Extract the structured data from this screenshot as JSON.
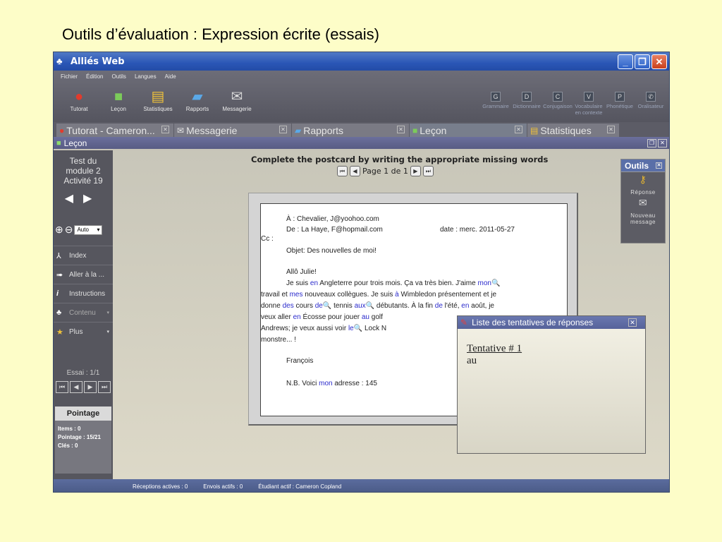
{
  "slide_title": "Outils d’évaluation : Expression écrite (essais)",
  "window": {
    "title": "Alliés Web",
    "minimize": "_",
    "maximize": "❐",
    "close": "✕"
  },
  "menu": [
    "Fichier",
    "Édition",
    "Outils",
    "Langues",
    "Aide"
  ],
  "toolbar_left": [
    {
      "label": "Tutorat",
      "icon": "apple-icon"
    },
    {
      "label": "Leçon",
      "icon": "lesson-icon"
    },
    {
      "label": "Statistiques",
      "icon": "statistics-icon"
    },
    {
      "label": "Rapports",
      "icon": "reports-icon"
    },
    {
      "label": "Messagerie",
      "icon": "mail-icon"
    }
  ],
  "toolbar_right": [
    {
      "label": "Grammaire",
      "letter": "G"
    },
    {
      "label": "Dictionnaire",
      "letter": "D"
    },
    {
      "label": "Conjugaison",
      "letter": "C"
    },
    {
      "label": "Vocabulaire en contexte",
      "letter": "V"
    },
    {
      "label": "Phonétique",
      "letter": "P"
    },
    {
      "label": "Oralisateur",
      "letter": "✆"
    }
  ],
  "tabs": [
    {
      "label": "Tutorat - Cameron...",
      "icon": "apple-icon"
    },
    {
      "label": "Messagerie",
      "icon": "mail-icon"
    },
    {
      "label": "Rapports",
      "icon": "reports-icon"
    },
    {
      "label": "Leçon",
      "icon": "lesson-icon"
    },
    {
      "label": "Statistiques",
      "icon": "statistics-icon"
    }
  ],
  "subbar_title": "Leçon",
  "left_panel": {
    "module_line1": "Test du",
    "module_line2": "module 2",
    "module_line3": "Activité 19",
    "zoom_value": "Auto",
    "items": [
      {
        "label": "Index",
        "icon": "index-icon"
      },
      {
        "label": "Aller à la ...",
        "icon": "goto-icon"
      },
      {
        "label": "Instructions",
        "icon": "info-icon"
      },
      {
        "label": "Contenu",
        "icon": "content-icon"
      },
      {
        "label": "Plus",
        "icon": "star-icon"
      }
    ],
    "essai": "Essai : 1/1",
    "pointage_title": "Pointage",
    "items_count": "Items : 0",
    "pointage_score": "Pointage : 15/21",
    "cles": "Clés : 0"
  },
  "lesson": {
    "instruction": "Complete the postcard by writing the appropriate missing words",
    "page_label": "Page 1 de 1"
  },
  "postcard": {
    "to": "À : Chevalier, J@yoohoo.com",
    "from": "De : La Haye, F@hopmail.com",
    "date": "date :  merc. 2011-05-27",
    "cc": "Cc :",
    "subject": "Objet:   Des nouvelles de moi!",
    "greeting": "Allô Julie!",
    "l1a": "Je suis ",
    "l1b": "en",
    "l1c": " Angleterre pour trois mois.  Ça va très bien. J'aime ",
    "l1d": "mon",
    "l2a": "travail et ",
    "l2b": "mes",
    "l2c": " nouveaux collègues.  Je suis ",
    "l2d": "à",
    "l2e": " Wimbledon présentement et je",
    "l3a": "donne ",
    "l3b": "des",
    "l3c": " cours ",
    "l3d": "de",
    "l3e": " tennis ",
    "l3f": "aux",
    "l3g": " débutants.  À la fin ",
    "l3h": "de",
    "l3i": " l'été, ",
    "l3j": "en",
    "l3k": " août, je",
    "l4a": "veux aller ",
    "l4b": "en",
    "l4c": " Écosse pour jouer ",
    "l4d": "au",
    "l4e": " golf",
    "l5a": "Andrews;  je veux aussi voir ",
    "l5b": "le",
    "l5c": " Lock N",
    "l6": "monstre... !",
    "signature": "François",
    "nb_a": "N.B.   Voici ",
    "nb_b": "mon",
    "nb_c": " adresse : 145"
  },
  "outils": {
    "title": "Outils",
    "reponse": "Réponse",
    "nouveau1": "Nouveau",
    "nouveau2": "message"
  },
  "popup": {
    "title": "Liste des tentatives de réponses",
    "attempt": "Tentative # 1",
    "answer": "au"
  },
  "status": {
    "receptions": "Réceptions actives : 0",
    "envois": "Envois actifs : 0",
    "etudiant": "Étudiant actif : Cameron Copland"
  },
  "colors": {
    "accent": "#2a56b6",
    "link": "#2a2acc",
    "page_bg": "#fdfdc8"
  }
}
